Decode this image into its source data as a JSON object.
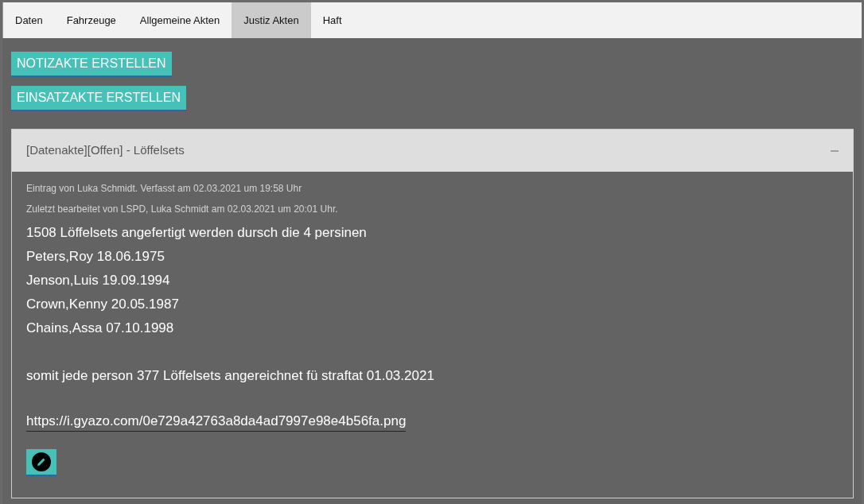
{
  "tabs": [
    {
      "label": "Daten",
      "selected": false
    },
    {
      "label": "Fahrzeuge",
      "selected": false
    },
    {
      "label": "Allgemeine Akten",
      "selected": false
    },
    {
      "label": "Justiz Akten",
      "selected": true
    },
    {
      "label": "Haft",
      "selected": false
    }
  ],
  "actions": [
    "NOTIZAKTE ERSTELLEN",
    "EINSATZAKTE ERSTELLEN"
  ],
  "record": {
    "title": "[Datenakte][Offen] - Löffelsets",
    "expanded": true,
    "meta": [
      "Eintrag von Luka Schmidt. Verfasst am 02.03.2021 um 19:58 Uhr",
      "Zuletzt bearbeitet von LSPD, Luka Schmidt am 02.03.2021 um 20:01 Uhr."
    ],
    "blocks": [
      {
        "kind": "text",
        "lines": [
          "1508 Löffelsets angefertigt werden dursch die 4 persinen",
          "Peters,Roy 18.06.1975",
          "Jenson,Luis 19.09.1994",
          "Crown,Kenny 20.05.1987",
          "Chains,Assa 07.10.1998"
        ]
      },
      {
        "kind": "text",
        "lines": [
          "somit jede person 377 Löffelsets angereichnet fü straftat 01.03.2021"
        ]
      },
      {
        "kind": "link",
        "lines": [
          "https://i.gyazo.com/0e729a42763a8da4ad7997e98e4b56fa.png"
        ]
      }
    ]
  }
}
